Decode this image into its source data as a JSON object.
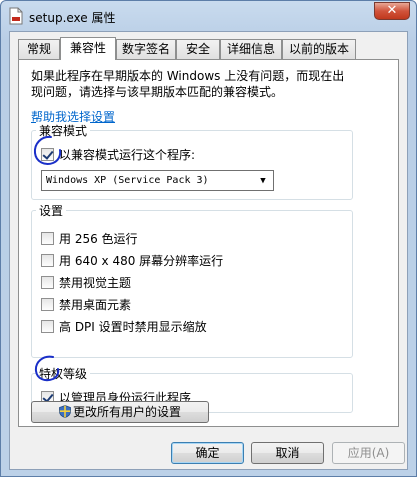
{
  "window": {
    "title": "setup.exe 属性",
    "close_label": "✕"
  },
  "tabs": [
    {
      "label": "常规",
      "active": false
    },
    {
      "label": "兼容性",
      "active": true
    },
    {
      "label": "数字签名",
      "active": false
    },
    {
      "label": "安全",
      "active": false
    },
    {
      "label": "详细信息",
      "active": false
    },
    {
      "label": "以前的版本",
      "active": false
    }
  ],
  "compat": {
    "intro_line1": "如果此程序在早期版本的 Windows 上没有问题，而现在出",
    "intro_line2": "现问题，请选择与该早期版本匹配的兼容模式。",
    "help_link": "帮助我选择设置",
    "mode_group": {
      "title": "兼容模式",
      "checkbox_label": "以兼容模式运行这个程序:",
      "checked": true,
      "selected_os": "Windows XP (Service Pack 3)"
    },
    "settings_group": {
      "title": "设置",
      "items": [
        {
          "label": "用 256 色运行",
          "checked": false
        },
        {
          "label": "用 640 x 480 屏幕分辨率运行",
          "checked": false
        },
        {
          "label": "禁用视觉主题",
          "checked": false
        },
        {
          "label": "禁用桌面元素",
          "checked": false
        },
        {
          "label": "高 DPI 设置时禁用显示缩放",
          "checked": false
        }
      ]
    },
    "privilege_group": {
      "title": "特权等级",
      "checkbox_label": "以管理员身份运行此程序",
      "checked": true
    },
    "all_users_button": "更改所有用户的设置"
  },
  "buttons": {
    "ok": "确定",
    "cancel": "取消",
    "apply": "应用(A)"
  },
  "colors": {
    "title_bar": "#c9dbee",
    "link": "#0066cc",
    "close_button": "#c0381d",
    "annotation_ink": "#1a2fc8"
  },
  "icons": {
    "title": "file-icon",
    "shield": "uac-shield-icon",
    "dropdown": "chevron-down-icon"
  }
}
